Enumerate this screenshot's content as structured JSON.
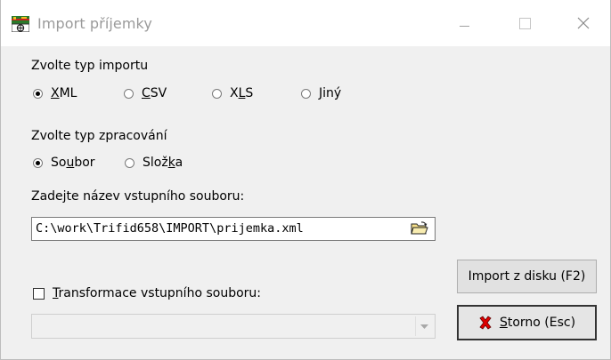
{
  "window": {
    "title": "Import příjemky",
    "icon": "trifid-app-icon",
    "controls": {
      "minimize": "minimize-icon",
      "maximize": "maximize-icon",
      "close": "close-icon"
    }
  },
  "import_type": {
    "label": "Zvolte typ importu",
    "options": [
      {
        "pre": "",
        "accel": "X",
        "post": "ML",
        "selected": true
      },
      {
        "pre": "",
        "accel": "C",
        "post": "SV",
        "selected": false
      },
      {
        "pre": "X",
        "accel": "L",
        "post": "S",
        "selected": false
      },
      {
        "pre": "",
        "accel": "J",
        "post": "iný",
        "selected": false
      }
    ]
  },
  "processing_type": {
    "label": "Zvolte typ zpracování",
    "options": [
      {
        "pre": "So",
        "accel": "u",
        "post": "bor",
        "selected": true
      },
      {
        "pre": "Slož",
        "accel": "k",
        "post": "a",
        "selected": false
      }
    ]
  },
  "input_file": {
    "label": "Zadejte název vstupního souboru:",
    "value": "C:\\work\\Trifid658\\IMPORT\\prijemka.xml",
    "browse_icon": "open-folder-icon"
  },
  "transform": {
    "accel": "T",
    "label_rest": "ransformace vstupního souboru:",
    "checked": false,
    "combo_value": ""
  },
  "buttons": {
    "import_label": "Import z disku (F2)",
    "cancel_accel": "S",
    "cancel_rest": "torno (Esc)",
    "cancel_icon": "red-x-icon"
  },
  "colors": {
    "title_text": "#9a9a9a",
    "dialog_bg": "#f0f0f0",
    "cancel_x": "#e00000"
  }
}
